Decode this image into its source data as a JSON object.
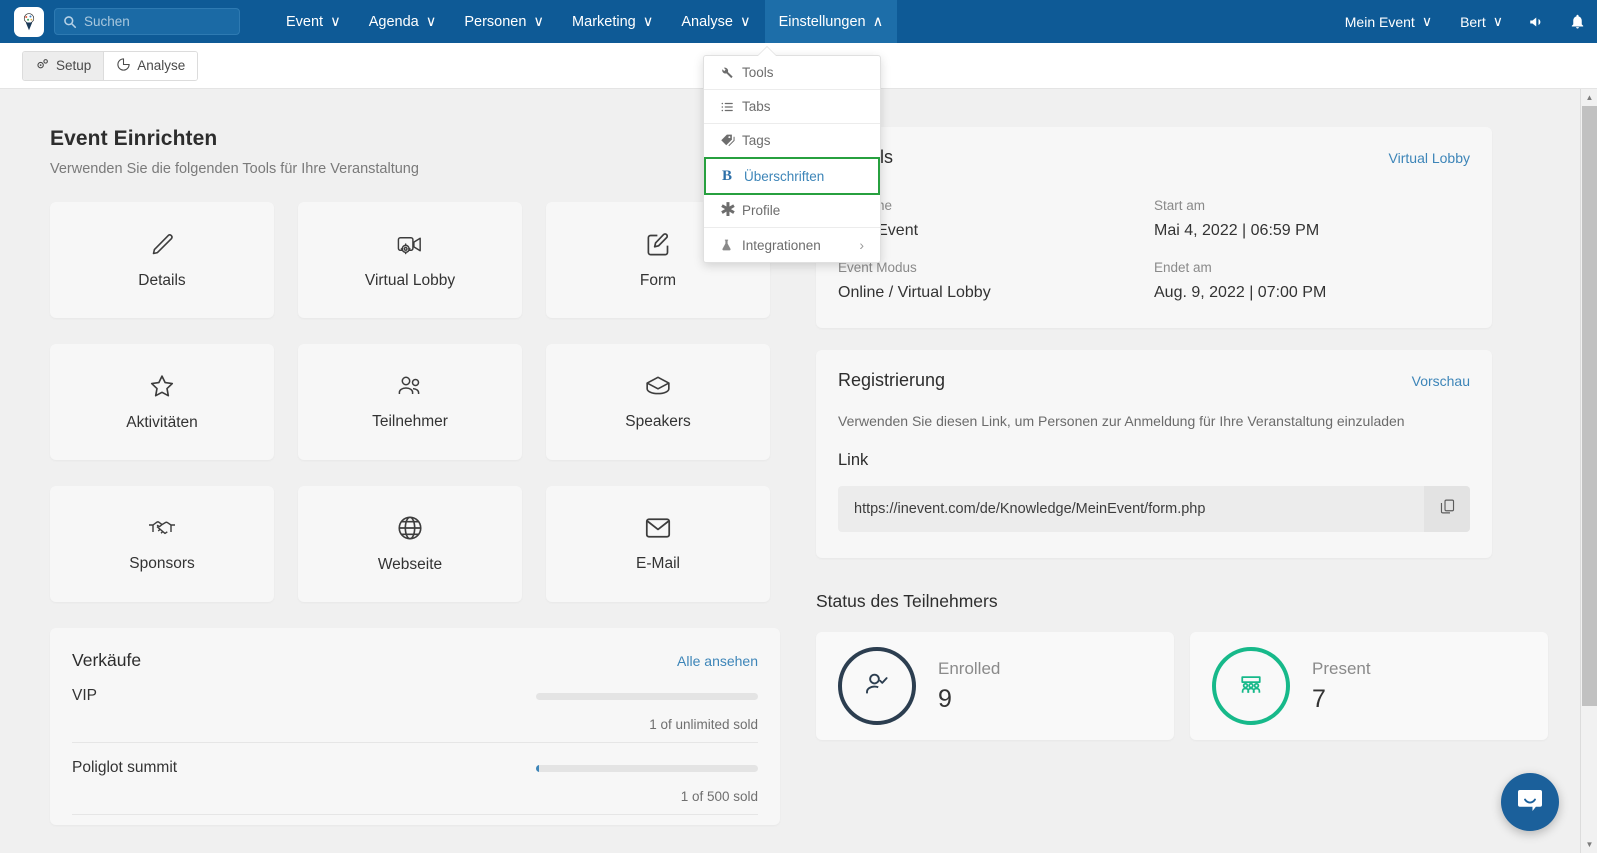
{
  "navbar": {
    "logo_alt": "inevent-logo",
    "search": {
      "value": "",
      "placeholder": "Suchen"
    },
    "items": [
      {
        "label": "Event",
        "caret": "∨",
        "active": false
      },
      {
        "label": "Agenda",
        "caret": "∨",
        "active": false
      },
      {
        "label": "Personen",
        "caret": "∨",
        "active": false
      },
      {
        "label": "Marketing",
        "caret": "∨",
        "active": false
      },
      {
        "label": "Analyse",
        "caret": "∨",
        "active": false
      },
      {
        "label": "Einstellungen",
        "caret": "∧",
        "active": true
      }
    ],
    "right": [
      {
        "label": "Mein Event",
        "caret": "∨"
      },
      {
        "label": "Bert",
        "caret": "∨"
      }
    ],
    "icons": [
      "megaphone-icon",
      "bell-icon"
    ],
    "accent_color": "#0e5a96",
    "active_color": "#1d6ea9"
  },
  "dropdown": {
    "items": [
      {
        "label": "Tools",
        "icon": "wrench-icon",
        "highlighted": false,
        "has_submenu": false
      },
      {
        "label": "Tabs",
        "icon": "list-icon",
        "highlighted": false,
        "has_submenu": false
      },
      {
        "label": "Tags",
        "icon": "tag-icon",
        "highlighted": false,
        "has_submenu": false
      },
      {
        "label": "Überschriften",
        "icon": "bold-b-icon",
        "highlighted": true,
        "has_submenu": false
      },
      {
        "label": "Profile",
        "icon": "asterisk-icon",
        "highlighted": false,
        "has_submenu": false
      },
      {
        "label": "Integrationen",
        "icon": "flask-icon",
        "highlighted": false,
        "has_submenu": true,
        "submenu_caret": "›"
      }
    ],
    "highlight_color": "#27a03f"
  },
  "subnav": {
    "tabs": [
      {
        "label": "Setup",
        "icon": "gears-icon",
        "active": true
      },
      {
        "label": "Analyse",
        "icon": "pie-chart-icon",
        "active": false
      }
    ]
  },
  "main": {
    "title": "Event Einrichten",
    "subtitle": "Verwenden Sie die folgenden Tools für Ihre Veranstaltung",
    "tools": [
      {
        "label": "Details",
        "icon": "pencil-icon"
      },
      {
        "label": "Virtual Lobby",
        "icon": "video-settings-icon"
      },
      {
        "label": "Form",
        "icon": "form-edit-icon"
      },
      {
        "label": "Aktivitäten",
        "icon": "star-icon"
      },
      {
        "label": "Teilnehmer",
        "icon": "people-icon"
      },
      {
        "label": "Speakers",
        "icon": "graduation-cap-icon"
      },
      {
        "label": "Sponsors",
        "icon": "handshake-icon"
      },
      {
        "label": "Webseite",
        "icon": "globe-icon"
      },
      {
        "label": "E-Mail",
        "icon": "envelope-icon"
      }
    ],
    "sales": {
      "title": "Verkäufe",
      "link_label": "Alle ansehen",
      "rows": [
        {
          "name": "VIP",
          "status": "1 of unlimited sold",
          "progress_pct": 0
        },
        {
          "name": "Poliglot summit",
          "status": "1 of 500 sold",
          "progress_pct": 1
        }
      ]
    }
  },
  "details": {
    "title": "Details",
    "link_label": "Virtual Lobby",
    "fields": [
      {
        "label": "Vorname",
        "value": "Mein Event"
      },
      {
        "label": "Start am",
        "value": "Mai 4, 2022 | 06:59 PM"
      },
      {
        "label": "Event Modus",
        "value": "Online / Virtual Lobby"
      },
      {
        "label": "Endet am",
        "value": "Aug. 9, 2022 | 07:00 PM"
      }
    ]
  },
  "registration": {
    "title": "Registrierung",
    "link_label": "Vorschau",
    "description": "Verwenden Sie diesen Link, um Personen zur Anmeldung für Ihre Veranstaltung einzuladen",
    "link_heading": "Link",
    "link_url": "https://inevent.com/de/Knowledge/MeinEvent/form.php",
    "copy_icon": "copy-icon"
  },
  "status": {
    "title": "Status des Teilnehmers",
    "cards": [
      {
        "label": "Enrolled",
        "value": "9",
        "icon": "user-check-icon",
        "color": "#2c3e50"
      },
      {
        "label": "Present",
        "value": "7",
        "icon": "audience-icon",
        "color": "#17b98a"
      }
    ]
  },
  "intercom": {
    "icon": "chat-bubble-icon",
    "color": "#1b609b"
  },
  "scrollbar": {
    "up": "▲",
    "down": "▼"
  }
}
